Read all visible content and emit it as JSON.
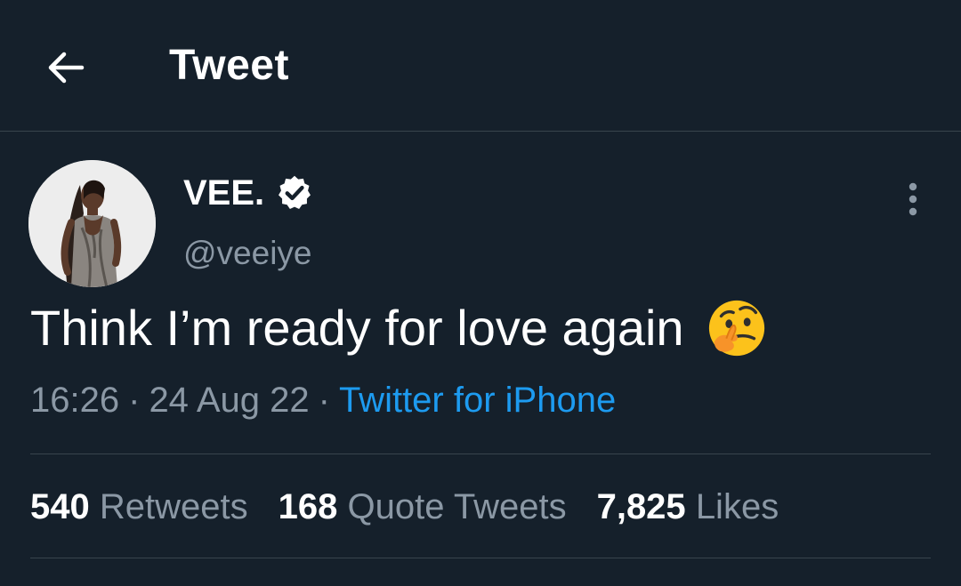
{
  "header": {
    "title": "Tweet",
    "back_icon": "arrow-left-icon"
  },
  "tweet": {
    "author": {
      "name": "VEE.",
      "handle": "@veeiye",
      "verified": true,
      "verified_icon": "verified-badge-icon"
    },
    "text": "Think I’m ready for love again",
    "emoji_icon": "thinking-face-emoji-icon",
    "time": "16:26",
    "separator": "·",
    "date": "24 Aug 22",
    "source": "Twitter for iPhone",
    "more_icon": "more-vertical-icon"
  },
  "stats": {
    "retweets_count": "540",
    "retweets_label": "Retweets",
    "quote_count": "168",
    "quote_label": "Quote Tweets",
    "likes_count": "7,825",
    "likes_label": "Likes"
  },
  "colors": {
    "background": "#15202b",
    "primary_text": "#ffffff",
    "secondary_text": "#8b98a5",
    "link": "#1d9bf0",
    "divider": "#38444d"
  }
}
